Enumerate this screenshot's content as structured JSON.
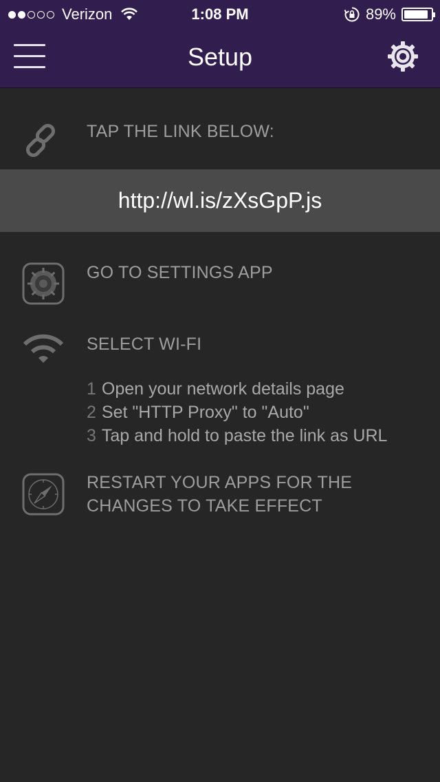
{
  "status_bar": {
    "signal_full": 2,
    "signal_total": 5,
    "carrier": "Verizon",
    "time": "1:08 PM",
    "battery_percent_text": "89%",
    "battery_level": 0.89
  },
  "nav": {
    "title": "Setup",
    "menu_icon": "hamburger-menu-icon",
    "settings_icon": "gear-icon",
    "bg_color": "#321d4f"
  },
  "steps": {
    "tap_link": {
      "icon": "link-icon",
      "label": "TAP THE LINK BELOW:"
    },
    "link_url": "http://wl.is/zXsGpP.js",
    "settings_app": {
      "icon": "settings-app-icon",
      "label": "GO TO SETTINGS APP"
    },
    "wifi": {
      "icon": "wifi-icon",
      "label": "SELECT WI-FI",
      "substeps": [
        {
          "num": "1",
          "text": "Open your network details page"
        },
        {
          "num": "2",
          "text": "Set \"HTTP Proxy\" to \"Auto\""
        },
        {
          "num": "3",
          "text": "Tap and hold to paste the link as URL"
        }
      ]
    },
    "restart": {
      "icon": "compass-icon",
      "label_line1": "RESTART YOUR APPS FOR THE",
      "label_line2": "CHANGES TO TAKE EFFECT"
    }
  }
}
